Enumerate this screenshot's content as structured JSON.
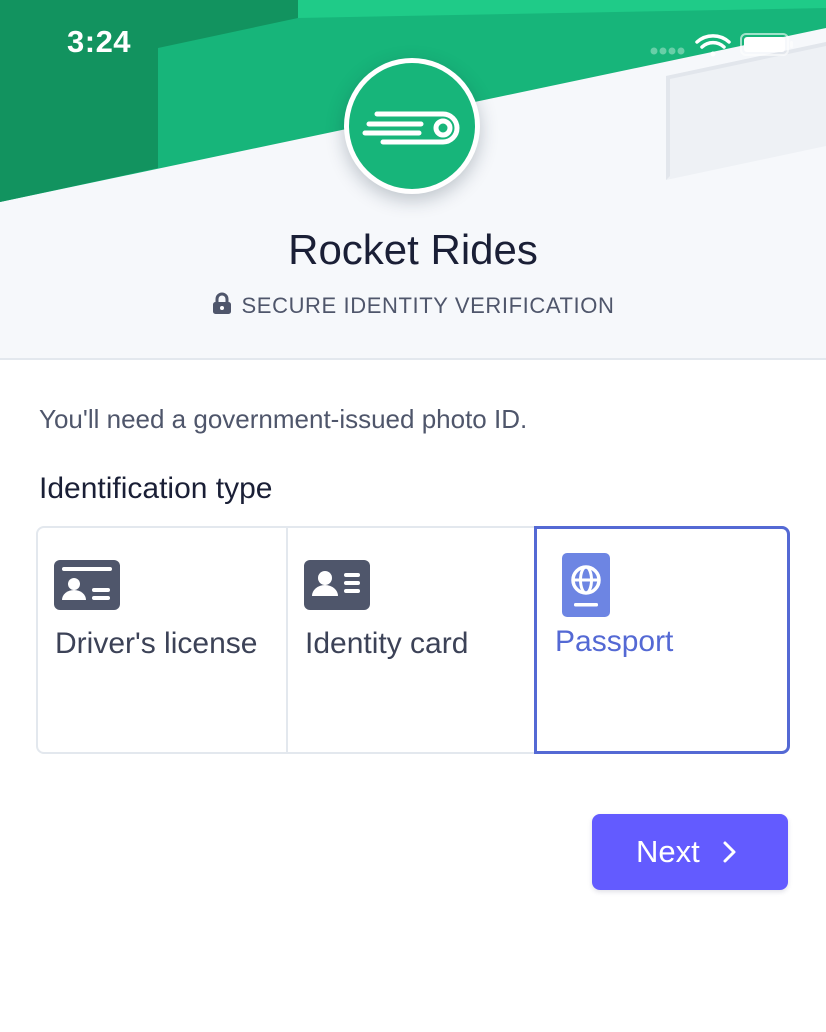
{
  "status_bar": {
    "time": "3:24"
  },
  "header": {
    "app_name": "Rocket Rides",
    "subtitle": "SECURE IDENTITY VERIFICATION",
    "logo_icon": "rocket-rides-logo-icon"
  },
  "main": {
    "intro": "You'll need a government-issued photo ID.",
    "section_label": "Identification type",
    "id_types": [
      {
        "label": "Driver's license",
        "icon": "drivers-license-icon",
        "selected": false
      },
      {
        "label": "Identity card",
        "icon": "identity-card-icon",
        "selected": false
      },
      {
        "label": "Passport",
        "icon": "passport-icon",
        "selected": true
      }
    ]
  },
  "footer": {
    "next_label": "Next"
  },
  "colors": {
    "brand_green": "#17b57a",
    "dark_green": "#12935f",
    "accent_blue": "#5469d4",
    "button_purple": "#635bff",
    "text_dark": "#1a1f36",
    "text_muted": "#4f566b"
  }
}
